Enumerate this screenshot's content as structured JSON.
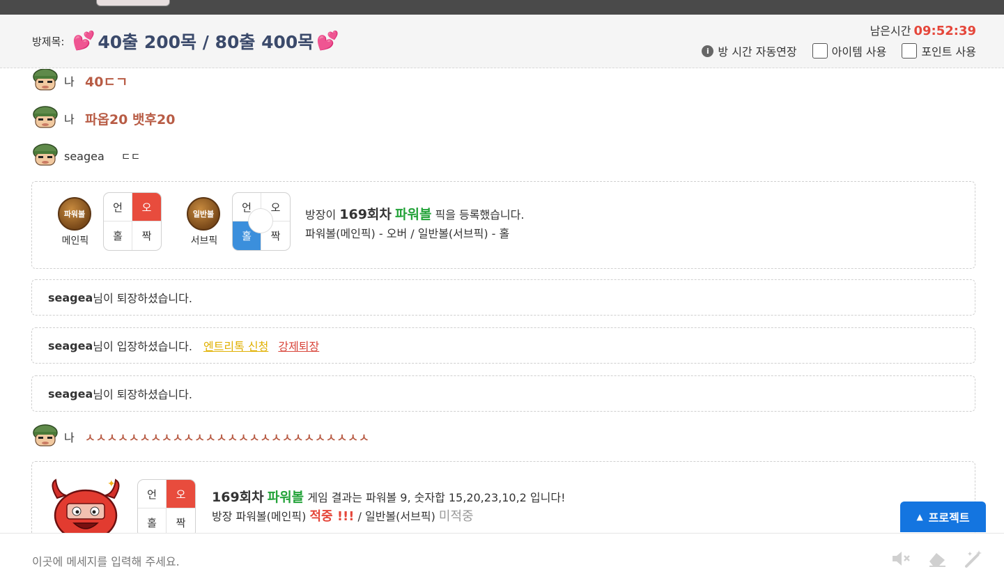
{
  "header": {
    "room_label": "방제목:",
    "room_title": "40출 200목 / 80출 400목",
    "remaining_label": "남은시간",
    "remaining_time": "09:52:39",
    "auto_extend_label": "방 시간 자동연장",
    "item_use_label": "아이템 사용",
    "point_use_label": "포인트 사용"
  },
  "messages": [
    {
      "name": "나",
      "text": "40ㄷㄱ"
    },
    {
      "name": "나",
      "text": "파옵20 뱃후20"
    },
    {
      "name": "seagea",
      "text": "ㄷㄷ"
    },
    {
      "name": "나",
      "text": "ㅅㅅㅅㅅㅅㅅㅅㅅㅅㅅㅅㅅㅅㅅㅅㅅㅅㅅㅅㅅㅅㅅㅅㅅㅅㅅ"
    }
  ],
  "pick_card": {
    "main_ball": "파워볼",
    "main_label": "메인픽",
    "sub_ball": "일반볼",
    "sub_label": "서브픽",
    "grid": [
      "언",
      "오",
      "홀",
      "짝"
    ],
    "line1_prefix": "방장이",
    "line1_round": "169회차",
    "line1_game": "파워볼",
    "line1_suffix": "픽을 등록했습니다.",
    "line2": "파워볼(메인픽) - 오버 / 일반볼(서브픽) - 홀"
  },
  "system_messages": [
    {
      "user": "seagea",
      "text": "님이 퇴장하셨습니다."
    },
    {
      "user": "seagea",
      "text": "님이 입장하셨습니다.",
      "link1": "엔트리톡 신청",
      "link2": "강제퇴장"
    },
    {
      "user": "seagea",
      "text": "님이 퇴장하셨습니다."
    }
  ],
  "result_card": {
    "grid": [
      "언",
      "오",
      "홀",
      "짝"
    ],
    "line1_round": "169회차",
    "line1_game": "파워볼",
    "line1_suffix": "게임 결과는 파워볼 9, 숫자합 15,20,23,10,2 입니다!",
    "line2_prefix": "방장 파워볼(메인픽)",
    "line2_hit": "적중 !!!",
    "line2_mid": "/ 일반볼(서브픽)",
    "line2_miss": "미적중"
  },
  "project_button": "프로젝트",
  "input": {
    "placeholder": "이곳에 메세지를 입력해 주세요."
  },
  "colors": {
    "accent_red": "#e5463a",
    "accent_blue": "#1475e0",
    "green": "#24a33a",
    "chat_text": "#b85c45"
  }
}
